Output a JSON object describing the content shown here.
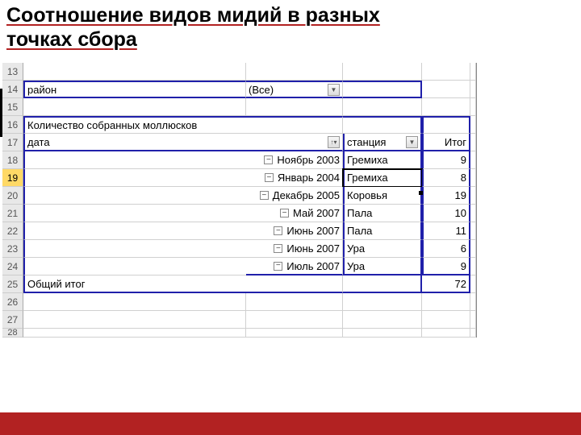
{
  "title_line1": "Соотношение видов мидий в разных",
  "title_line2": "точках сбора",
  "row_numbers": [
    "13",
    "14",
    "15",
    "16",
    "17",
    "18",
    "19",
    "20",
    "21",
    "22",
    "23",
    "24",
    "25",
    "26",
    "27",
    "28"
  ],
  "filter": {
    "field": "район",
    "value": "(Все)"
  },
  "pivot": {
    "measure_label": "Количество собранных моллюсков",
    "row_field": "дата",
    "col_field": "станция",
    "total_col_header": "Итог",
    "grand_total_label": "Общий итог",
    "grand_total_value": "72"
  },
  "rows": [
    {
      "date": "Ноябрь 2003",
      "station": "Гремиха",
      "total": "9"
    },
    {
      "date": "Январь 2004",
      "station": "Гремиха",
      "total": "8"
    },
    {
      "date": "Декабрь 2005",
      "station": "Коровья",
      "total": "19"
    },
    {
      "date": "Май 2007",
      "station": "Пала",
      "total": "10"
    },
    {
      "date": "Июнь 2007",
      "station": "Пала",
      "total": "11"
    },
    {
      "date": "Июнь 2007",
      "station": "Ура",
      "total": "6"
    },
    {
      "date": "Июль 2007",
      "station": "Ура",
      "total": "9"
    }
  ],
  "chart_data": {
    "type": "table",
    "title": "Количество собранных моллюсков по датам и станциям",
    "columns": [
      "дата",
      "станция",
      "Итог"
    ],
    "rows": [
      [
        "Ноябрь 2003",
        "Гремиха",
        9
      ],
      [
        "Январь 2004",
        "Гремиха",
        8
      ],
      [
        "Декабрь 2005",
        "Коровья",
        19
      ],
      [
        "Май 2007",
        "Пала",
        10
      ],
      [
        "Июнь 2007",
        "Пала",
        11
      ],
      [
        "Июнь 2007",
        "Ура",
        6
      ],
      [
        "Июль 2007",
        "Ура",
        9
      ]
    ],
    "grand_total": 72,
    "filter": {
      "район": "(Все)"
    }
  }
}
